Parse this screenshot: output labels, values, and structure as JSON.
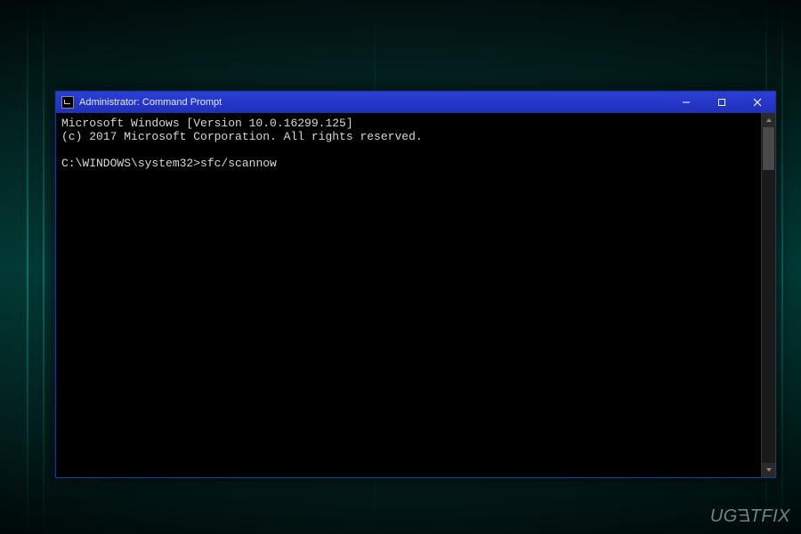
{
  "window": {
    "title": "Administrator: Command Prompt"
  },
  "terminal": {
    "line1": "Microsoft Windows [Version 10.0.16299.125]",
    "line2": "(c) 2017 Microsoft Corporation. All rights reserved.",
    "blank": "",
    "prompt_path": "C:\\WINDOWS\\system32>",
    "command": "sfc/scannow"
  },
  "watermark": {
    "text_prefix": "UG",
    "text_e": "E",
    "text_suffix": "TFIX"
  }
}
